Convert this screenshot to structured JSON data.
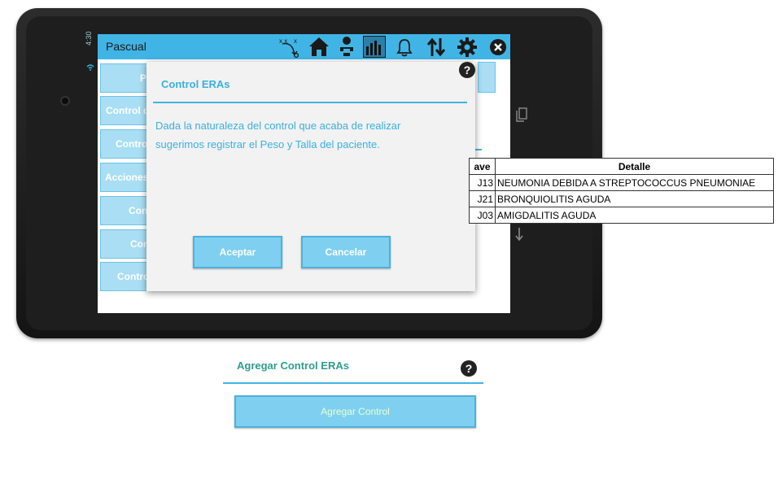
{
  "device": {
    "status_time": "4:30"
  },
  "app": {
    "title": "Pascual",
    "toolbar_icons": [
      "strategy-icon",
      "home-icon",
      "baby-icon",
      "chart-icon",
      "bell-icon",
      "sync-icon",
      "gear-icon",
      "close-icon"
    ]
  },
  "sidebar": {
    "items": [
      {
        "label": "Pa"
      },
      {
        "label": "Control d"
      },
      {
        "label": "Control"
      },
      {
        "label": "Acciones"
      },
      {
        "label": "Cont"
      },
      {
        "label": "Con"
      },
      {
        "label": "Control"
      }
    ]
  },
  "modal": {
    "title": "Control ERAs",
    "body_line1": "Dada la naturaleza del control que acaba de realizar",
    "body_line2": "sugerimos registrar el Peso y Talla del paciente.",
    "accept_label": "Aceptar",
    "cancel_label": "Cancelar",
    "help_label": "?"
  },
  "diagnoses_table": {
    "headers": [
      "ave",
      "Detalle"
    ],
    "rows": [
      {
        "code": "J13",
        "detail": "NEUMONIA DEBIDA A STREPTOCOCCUS PNEUMONIAE"
      },
      {
        "code": "J21",
        "detail": "BRONQUIOLITIS AGUDA"
      },
      {
        "code": "J03",
        "detail": "AMIGDALITIS AGUDA"
      }
    ]
  },
  "section": {
    "title": "Agregar Control ERAs",
    "help_label": "?",
    "button_label": "Agregar Control"
  },
  "colors": {
    "accent": "#41b4e6",
    "button_fill": "#7fd0f0",
    "sidebar_fill": "#a9def4",
    "section_title": "#2e9d8c"
  }
}
